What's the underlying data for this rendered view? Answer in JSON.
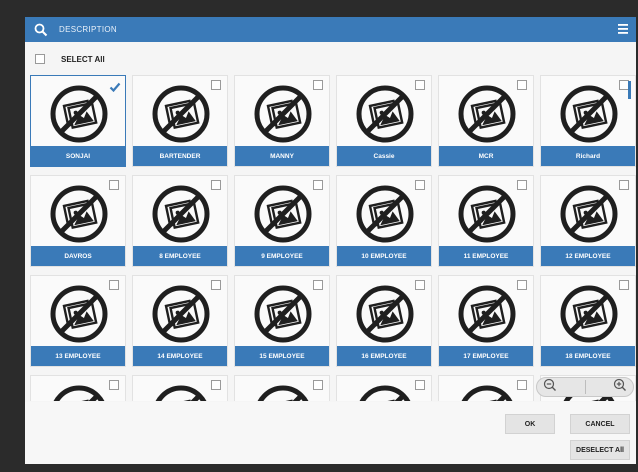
{
  "header": {
    "title": "DESCRIPTION",
    "search_icon": "search-icon",
    "menu_icon": "hamburger-menu-icon",
    "bg_color": "#3a7ab8"
  },
  "select_all": {
    "label": "SELECT All",
    "checked": false
  },
  "tiles": [
    {
      "label": "SONJAI",
      "checked": true
    },
    {
      "label": "BARTENDER",
      "checked": false
    },
    {
      "label": "MANNY",
      "checked": false
    },
    {
      "label": "Cassie",
      "checked": false
    },
    {
      "label": "MCR",
      "checked": false
    },
    {
      "label": "Richard",
      "checked": false
    },
    {
      "label": "DAVROS",
      "checked": false
    },
    {
      "label": "8 EMPLOYEE",
      "checked": false
    },
    {
      "label": "9 EMPLOYEE",
      "checked": false
    },
    {
      "label": "10 EMPLOYEE",
      "checked": false
    },
    {
      "label": "11 EMPLOYEE",
      "checked": false
    },
    {
      "label": "12 EMPLOYEE",
      "checked": false
    },
    {
      "label": "13 EMPLOYEE",
      "checked": false
    },
    {
      "label": "14 EMPLOYEE",
      "checked": false
    },
    {
      "label": "15 EMPLOYEE",
      "checked": false
    },
    {
      "label": "16 EMPLOYEE",
      "checked": false
    },
    {
      "label": "17 EMPLOYEE",
      "checked": false
    },
    {
      "label": "18 EMPLOYEE",
      "checked": false
    },
    {
      "label": "",
      "checked": false
    },
    {
      "label": "",
      "checked": false
    },
    {
      "label": "",
      "checked": false
    },
    {
      "label": "",
      "checked": false
    },
    {
      "label": "",
      "checked": false
    },
    {
      "label": "",
      "checked": false
    }
  ],
  "tile_icon": "no-image-icon",
  "zoom": {
    "out_icon": "zoom-out-icon",
    "in_icon": "zoom-in-icon"
  },
  "footer": {
    "ok_label": "OK",
    "cancel_label": "CANCEL",
    "deselect_all_label": "DESELECT All"
  }
}
